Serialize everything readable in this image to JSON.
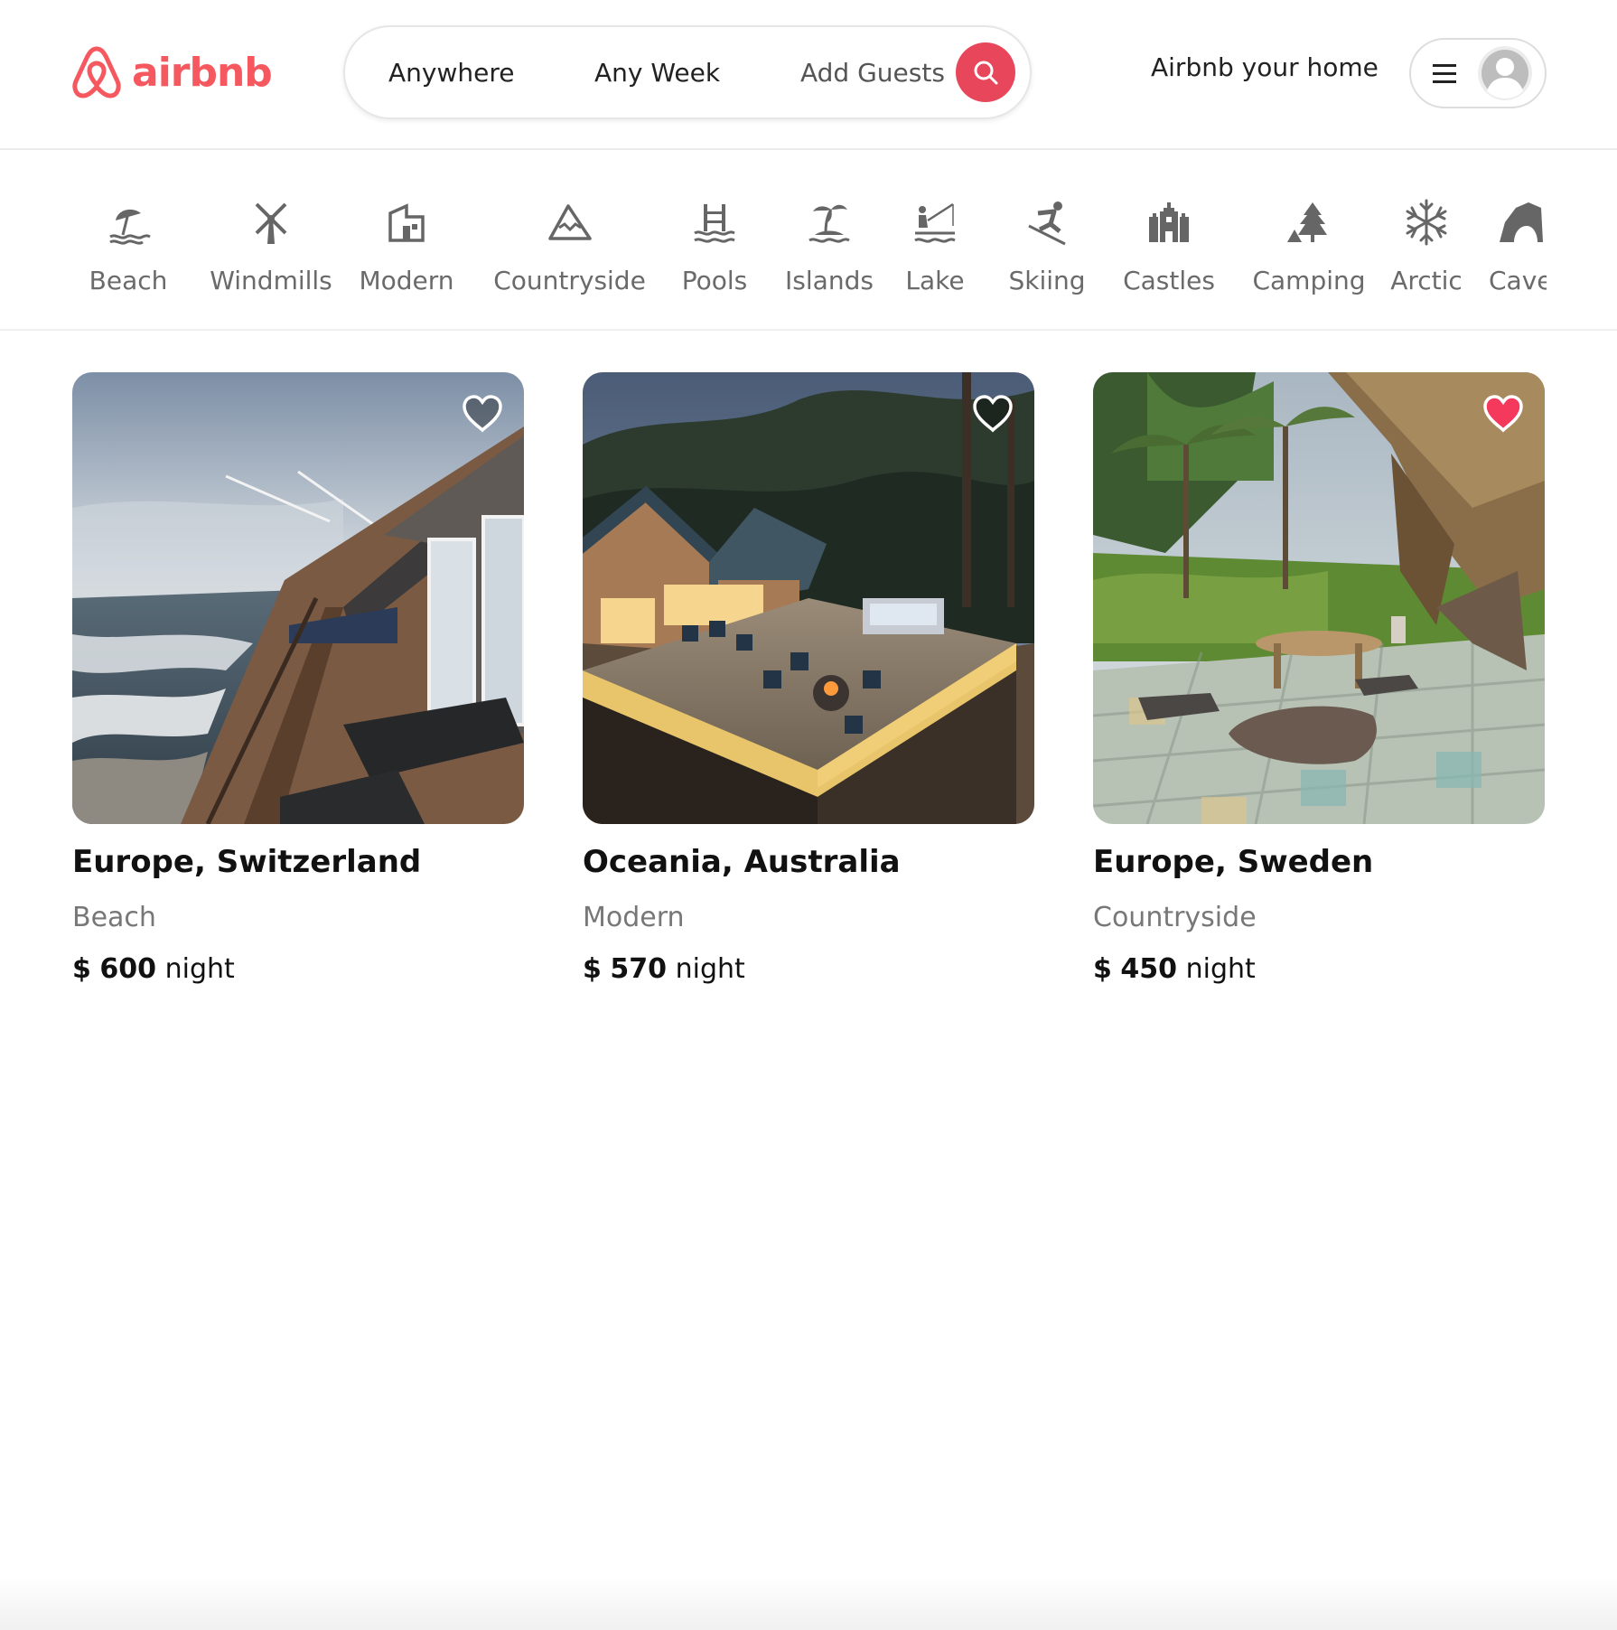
{
  "brand": {
    "name": "airbnb",
    "color": "#f5595f"
  },
  "search": {
    "where": "Anywhere",
    "when": "Any Week",
    "guests": "Add Guests",
    "button_icon": "search-icon",
    "button_color": "#e8465b"
  },
  "header": {
    "host_link": "Airbnb your home",
    "menu_icon": "hamburger-icon",
    "avatar_icon": "user-avatar-icon"
  },
  "categories": [
    {
      "label": "Beach",
      "icon": "beach-umbrella-icon"
    },
    {
      "label": "Windmills",
      "icon": "windmill-icon"
    },
    {
      "label": "Modern",
      "icon": "modern-building-icon"
    },
    {
      "label": "Countryside",
      "icon": "mountain-icon"
    },
    {
      "label": "Pools",
      "icon": "pool-icon"
    },
    {
      "label": "Islands",
      "icon": "island-icon"
    },
    {
      "label": "Lake",
      "icon": "lake-fishing-icon"
    },
    {
      "label": "Skiing",
      "icon": "skier-icon"
    },
    {
      "label": "Castles",
      "icon": "castle-icon"
    },
    {
      "label": "Camping",
      "icon": "camping-icon"
    },
    {
      "label": "Arctic",
      "icon": "snowflake-icon"
    },
    {
      "label": "Caves",
      "icon": "cave-icon"
    }
  ],
  "listings": [
    {
      "location": "Europe, Switzerland",
      "category": "Beach",
      "currency": "$",
      "price": "600",
      "unit": "night",
      "favorite": false
    },
    {
      "location": "Oceania, Australia",
      "category": "Modern",
      "currency": "$",
      "price": "570",
      "unit": "night",
      "favorite": false
    },
    {
      "location": "Europe, Sweden",
      "category": "Countryside",
      "currency": "$",
      "price": "450",
      "unit": "night",
      "favorite": true
    }
  ],
  "colors": {
    "favorite_heart": "#f5395c",
    "text_muted": "#777777"
  }
}
